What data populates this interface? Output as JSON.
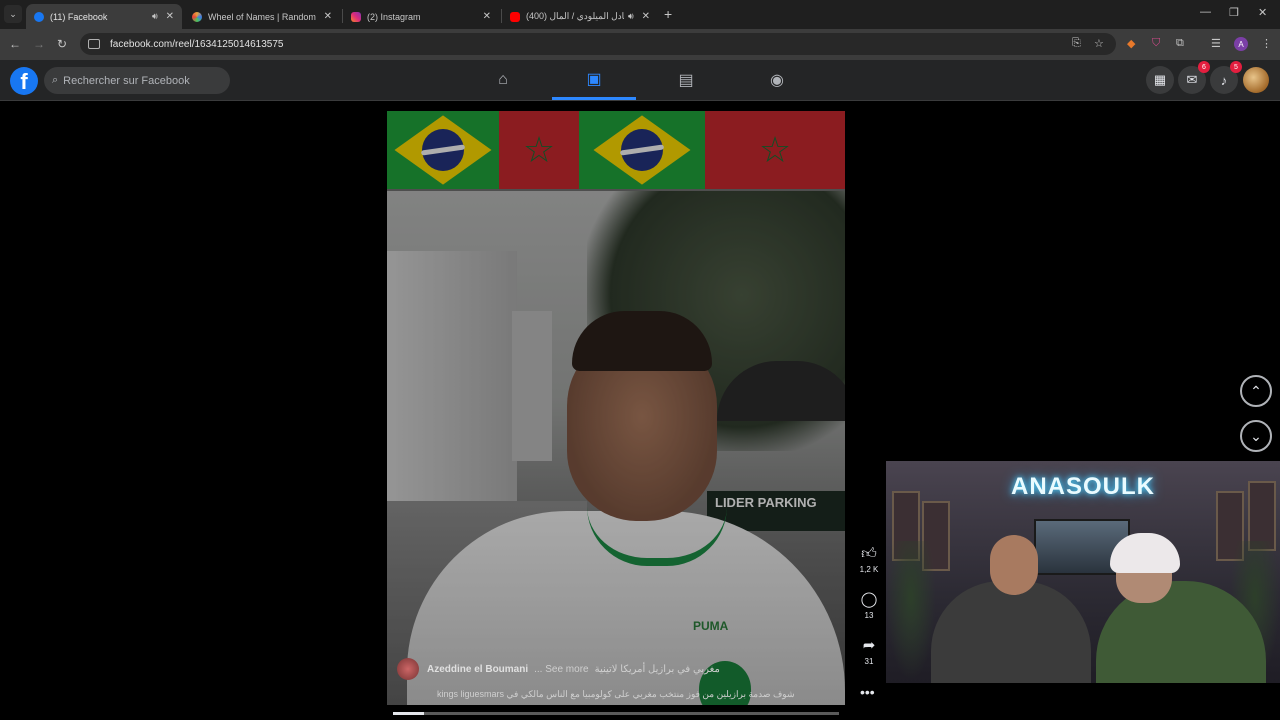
{
  "browser": {
    "tabs": [
      {
        "title": "(11) Facebook",
        "favicon_color": "#1877f2",
        "audio": true,
        "active": true
      },
      {
        "title": "Wheel of Names | Random nam",
        "favicon_color": "#e9a23b",
        "audio": false,
        "active": false
      },
      {
        "title": "(2) Instagram",
        "favicon_color": "#d6249f",
        "audio": false,
        "active": false
      },
      {
        "title": "(400) عادل الميلودي / المال |",
        "favicon_color": "#ff0000",
        "audio": true,
        "active": false
      }
    ],
    "url": "facebook.com/reel/1634125014613575",
    "profile_initial": "A"
  },
  "facebook": {
    "logo": "f",
    "search_placeholder": "Rechercher sur Facebook",
    "nav": [
      {
        "icon": "home-icon",
        "glyph": "⌂",
        "active": false
      },
      {
        "icon": "reels-icon",
        "glyph": "▣",
        "active": true
      },
      {
        "icon": "marketplace-icon",
        "glyph": "▤",
        "active": false
      },
      {
        "icon": "gaming-icon",
        "glyph": "◉",
        "active": false
      }
    ],
    "messenger_badge": "6",
    "notifications_badge": "5"
  },
  "reel": {
    "author": "Azeddine el Boumani",
    "description": "مغربي في برازيل أمريكا لاتينية",
    "more_label": "... See more",
    "caption": "kings liguesmars شوف صدمة برازيلين من فوز منتخب مغربي على كولومبيا مع الناس مالكي في",
    "brand_sign": "LIDER PARKING",
    "shirt_brand": "PUMA",
    "progress": 0.07
  },
  "actions": {
    "likes": "1,2 K",
    "comments": "13",
    "shares": "31"
  },
  "stream": {
    "neon_text": "ANASOULK"
  },
  "colors": {
    "facebook_blue": "#1877f2",
    "active_nav": "#2d88ff",
    "badge_red": "#e41e3f",
    "neon": "#4fd6ff"
  }
}
